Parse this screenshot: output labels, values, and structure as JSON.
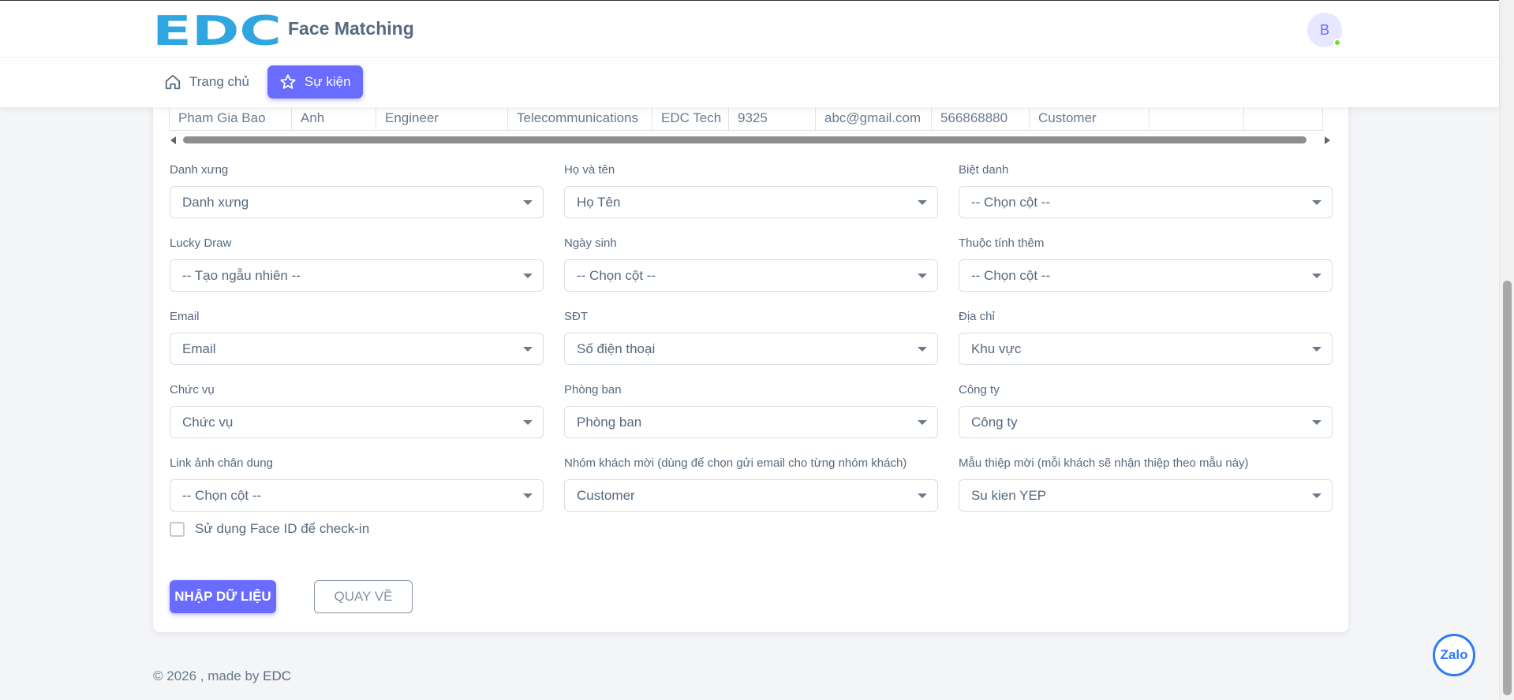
{
  "header": {
    "logo_text": "EDC",
    "app_name": "Face Matching",
    "avatar_initial": "B"
  },
  "nav": {
    "items": [
      {
        "label": "Trang chủ",
        "icon": "home-icon"
      },
      {
        "label": "Sự kiện",
        "icon": "star-icon",
        "active": true
      }
    ]
  },
  "preview_table": {
    "cells": [
      "Pham Gia Bao",
      "Anh",
      "Engineer",
      "Telecommunications",
      "EDC Tech",
      "9325",
      "abc@gmail.com",
      "566868880",
      "Customer",
      "",
      ""
    ]
  },
  "form": {
    "fields": [
      {
        "label": "Danh xưng",
        "value": "Danh xưng"
      },
      {
        "label": "Họ và tên",
        "value": "Họ Tên"
      },
      {
        "label": "Biệt danh",
        "value": "-- Chọn cột --"
      },
      {
        "label": "Lucky Draw",
        "value": "-- Tạo ngẫu nhiên --"
      },
      {
        "label": "Ngày sinh",
        "value": "-- Chọn cột --"
      },
      {
        "label": "Thuộc tính thêm",
        "value": "-- Chọn cột --"
      },
      {
        "label": "Email",
        "value": "Email"
      },
      {
        "label": "SĐT",
        "value": "Số điện thoại"
      },
      {
        "label": "Địa chỉ",
        "value": "Khu vực"
      },
      {
        "label": "Chức vụ",
        "value": "Chức vụ"
      },
      {
        "label": "Phòng ban",
        "value": "Phòng ban"
      },
      {
        "label": "Công ty",
        "value": "Công ty"
      },
      {
        "label": "Link ảnh chân dung",
        "value": "-- Chọn cột --"
      },
      {
        "label": "Nhóm khách mời (dùng để chọn gửi email cho từng nhóm khách)",
        "value": "Customer"
      },
      {
        "label": "Mẫu thiệp mời (mỗi khách sẽ nhận thiệp theo mẫu này)",
        "value": "Su kien YEP"
      }
    ],
    "faceid_label": "Sử dụng Face ID để check-in",
    "faceid_checked": false,
    "import_button": "NHẬP DỮ LIỆU",
    "back_button": "QUAY VỀ"
  },
  "footer": {
    "prefix": "© 2026 , made by ",
    "brand": "EDC"
  },
  "widgets": {
    "zalo_label": "Zalo"
  },
  "colors": {
    "primary": "#696cff",
    "logo_blue": "#2fa6e0",
    "online": "#71dd37",
    "zalo": "#2e7bf6"
  }
}
